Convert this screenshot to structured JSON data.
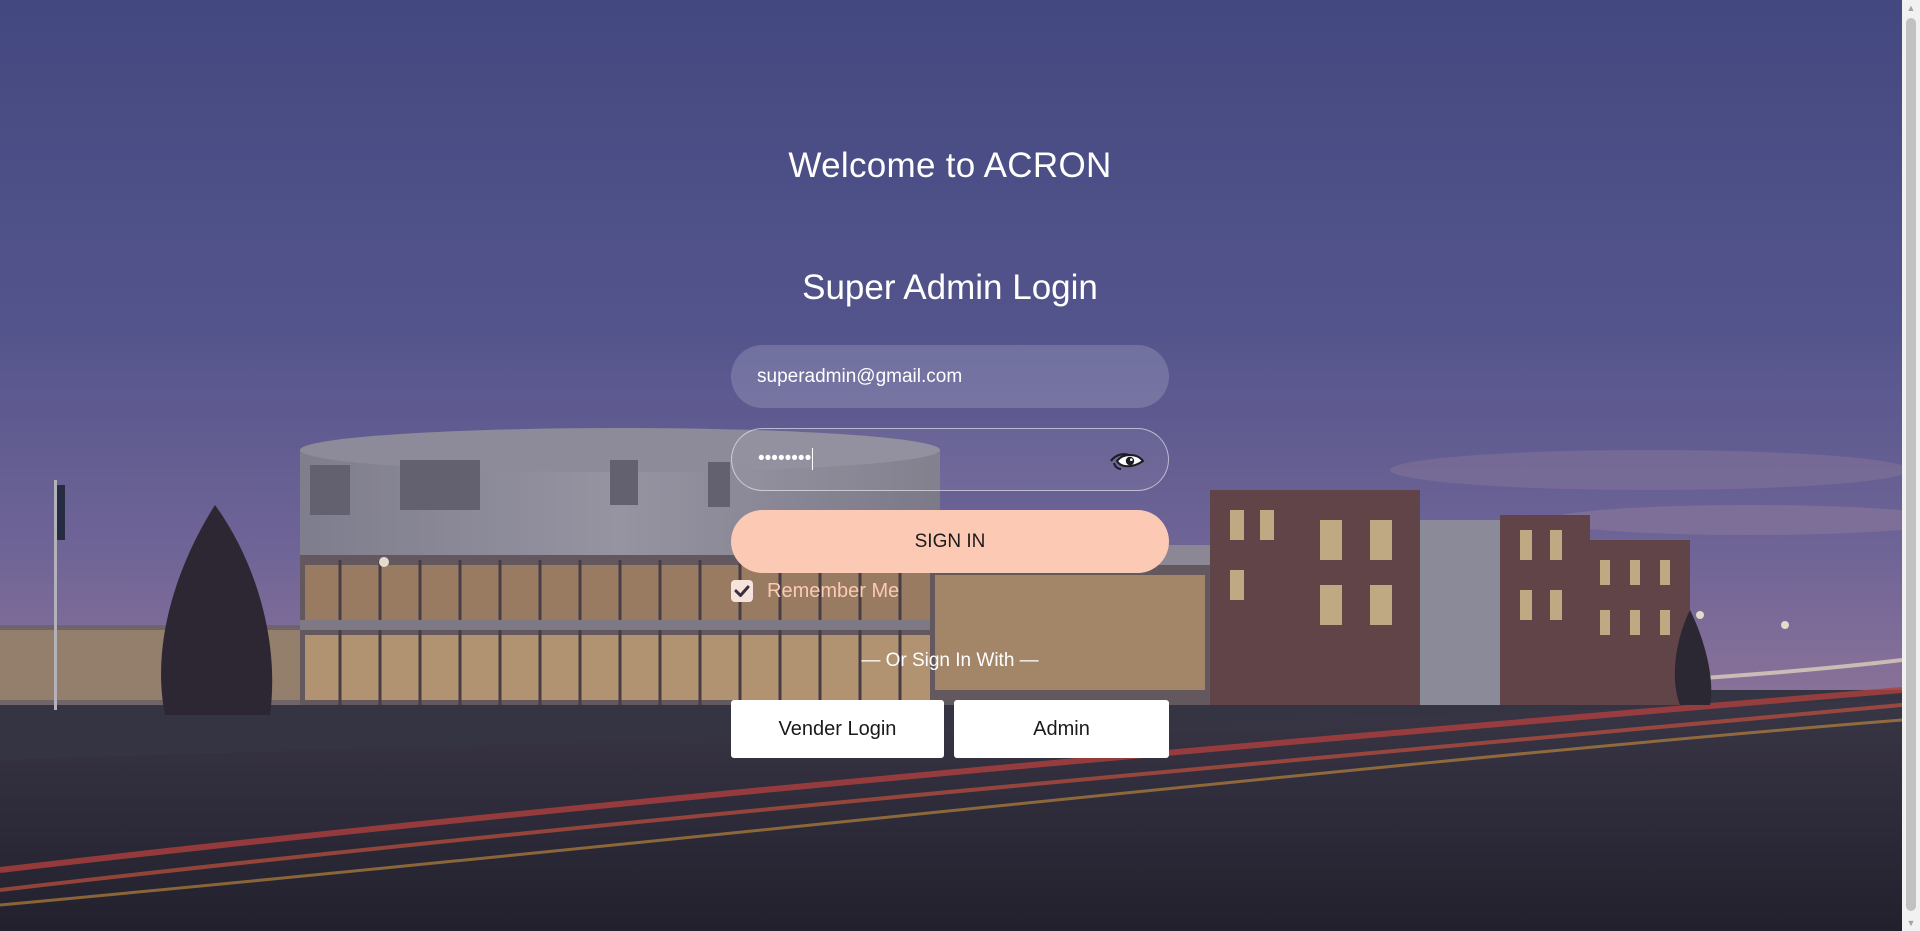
{
  "page": {
    "welcome_heading": "Welcome to ACRON",
    "login_title": "Super Admin Login"
  },
  "form": {
    "email_value": "superadmin@gmail.com",
    "password_masked": "••••••••",
    "password_toggle_icon": "eye-icon",
    "signin_label": "SIGN IN",
    "remember_label": "Remember Me",
    "remember_checked": true
  },
  "alternate": {
    "divider_text": "— Or Sign In With —",
    "vendor_label": "Vender Login",
    "admin_label": "Admin"
  },
  "colors": {
    "accent": "#fccab4",
    "sky_top": "#4e4f8c",
    "sky_horizon": "#8c78a6"
  }
}
